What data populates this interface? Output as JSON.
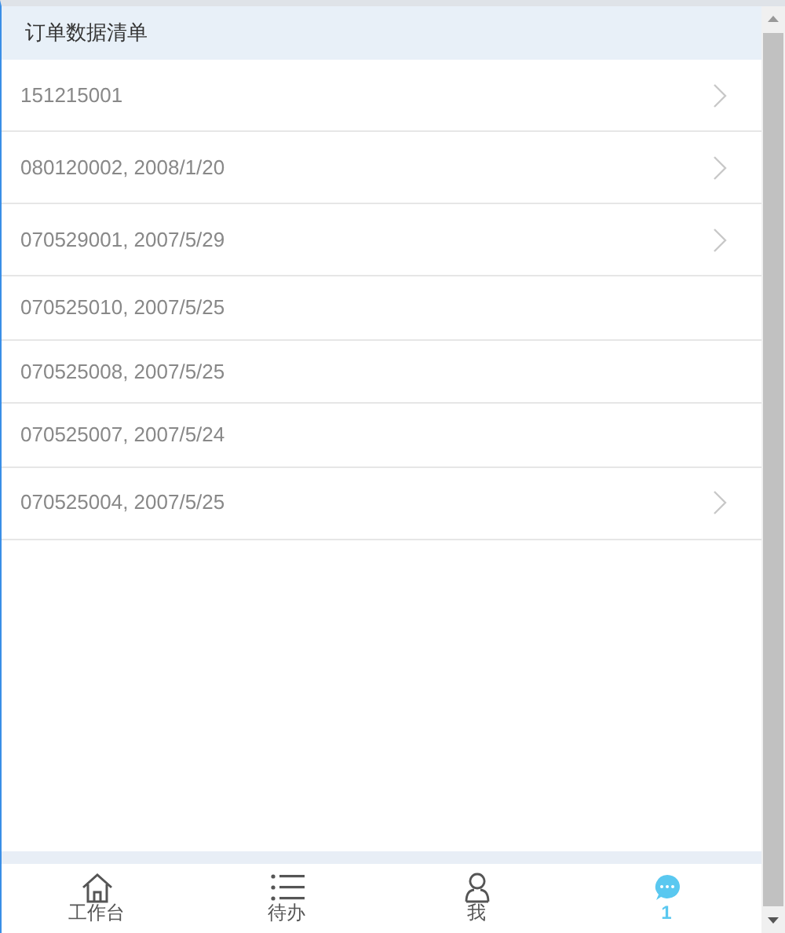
{
  "header": {
    "title": "订单数据清单"
  },
  "orders": [
    {
      "label": "151215001",
      "chevron": true
    },
    {
      "label": "080120002, 2008/1/20",
      "chevron": true
    },
    {
      "label": "070529001, 2007/5/29",
      "chevron": true
    },
    {
      "label": "070525010, 2007/5/25",
      "chevron": false
    },
    {
      "label": "070525008, 2007/5/25",
      "chevron": false
    },
    {
      "label": "070525007, 2007/5/24",
      "chevron": false
    },
    {
      "label": "070525004, 2007/5/25",
      "chevron": true
    }
  ],
  "tabs": [
    {
      "kind": "home",
      "label": "工作台",
      "selected": false
    },
    {
      "kind": "list",
      "label": "待办",
      "selected": false
    },
    {
      "kind": "person",
      "label": "我",
      "selected": false
    },
    {
      "kind": "chat",
      "label": "1",
      "selected": true
    }
  ]
}
